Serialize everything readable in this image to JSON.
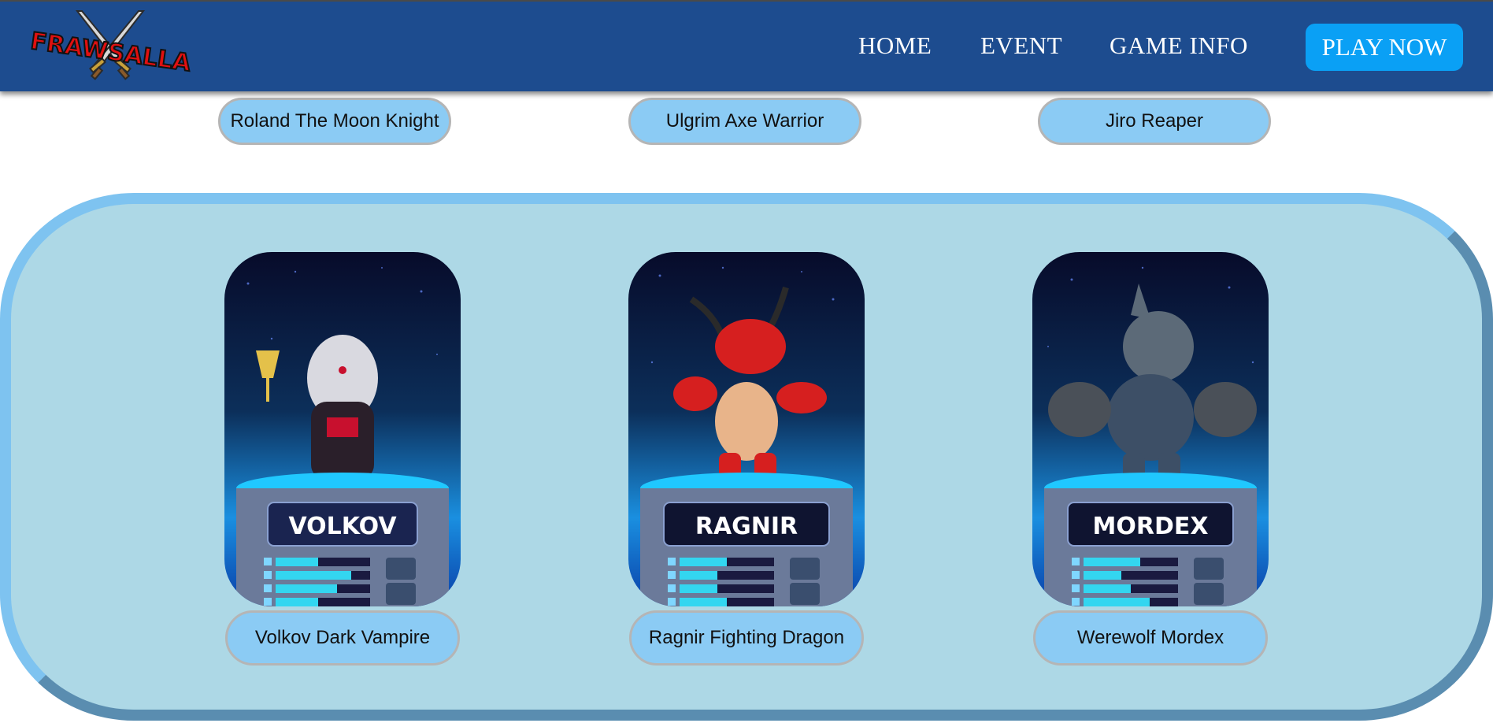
{
  "nav": {
    "logo_text": "FRAWSALLA",
    "links": [
      "HOME",
      "EVENT",
      "GAME INFO"
    ],
    "cta": "PLAY NOW"
  },
  "top_row": {
    "names": [
      "Roland The Moon Knight",
      "Ulgrim Axe Warrior",
      "Jiro Reaper"
    ]
  },
  "featured": {
    "cards": [
      {
        "badge": "VOLKOV",
        "name": "Volkov Dark Vampire",
        "stats": [
          0.45,
          0.8,
          0.65,
          0.45
        ]
      },
      {
        "badge": "RAGNIR",
        "name": "Ragnir Fighting Dragon",
        "stats": [
          0.5,
          0.4,
          0.4,
          0.5
        ]
      },
      {
        "badge": "MORDEX",
        "name": "Werewolf Mordex",
        "stats": [
          0.6,
          0.4,
          0.5,
          0.7
        ]
      }
    ]
  },
  "colors": {
    "navbar": "#1d4c8f",
    "cta": "#0aa0f5",
    "pill": "#8bcbf4",
    "panel": "#add8e6"
  }
}
